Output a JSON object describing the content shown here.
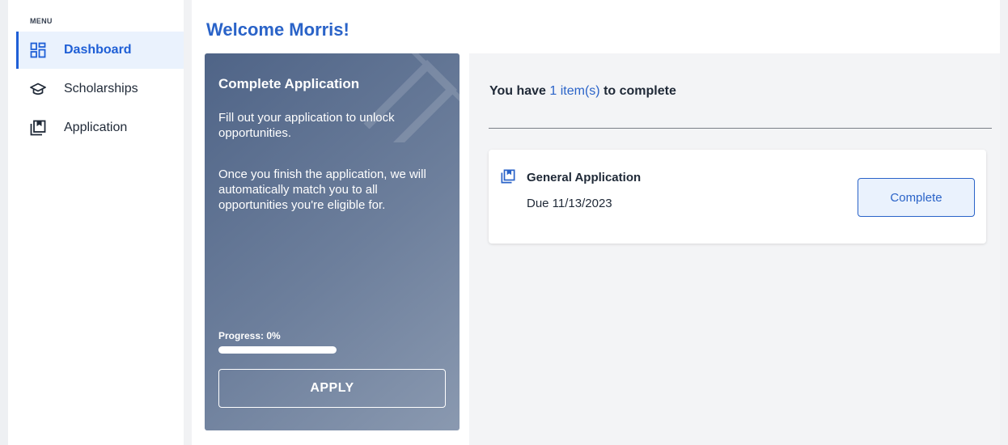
{
  "sidebar": {
    "menu_label": "MENU",
    "items": [
      {
        "label": "Dashboard",
        "icon": "dashboard-icon",
        "active": true
      },
      {
        "label": "Scholarships",
        "icon": "graduation-cap-icon",
        "active": false
      },
      {
        "label": "Application",
        "icon": "application-icon",
        "active": false
      }
    ]
  },
  "header": {
    "welcome": "Welcome Morris!"
  },
  "promo": {
    "title": "Complete Application",
    "text1": "Fill out your application to unlock opportunities.",
    "text2": "Once you finish the application, we will automatically match you to all opportunities you're eligible for.",
    "progress_label": "Progress: 0%",
    "progress_value": 0,
    "apply_label": "APPLY"
  },
  "tasks": {
    "heading_prefix": "You have ",
    "heading_count": "1 item(s)",
    "heading_suffix": " to complete",
    "items": [
      {
        "title": "General Application",
        "due": "Due 11/13/2023",
        "button_label": "Complete",
        "icon": "application-icon"
      }
    ]
  },
  "colors": {
    "accent": "#2a63c8",
    "active_bg": "#eaf2fd",
    "promo_gradient_start": "#4f6487",
    "promo_gradient_end": "#8a99b0"
  }
}
